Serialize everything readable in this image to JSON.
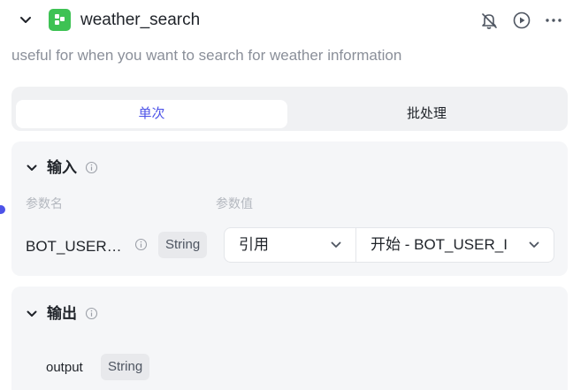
{
  "node": {
    "title": "weather_search",
    "description": "useful for when you want to search for weather information"
  },
  "icons": {
    "collapse": "chevron-down-icon",
    "node": "plugin-node-icon",
    "debug_off": "bell-off-icon",
    "run": "play-circle-icon",
    "more": "more-horizontal-icon",
    "info": "info-icon"
  },
  "tabs": [
    {
      "label": "单次",
      "active": true
    },
    {
      "label": "批处理",
      "active": false
    }
  ],
  "input": {
    "title": "输入",
    "col_name": "参数名",
    "col_value": "参数值",
    "params": [
      {
        "name": "BOT_USER…",
        "type": "String",
        "source": "引用",
        "value": "开始 - BOT_USER_I"
      }
    ]
  },
  "output": {
    "title": "输出",
    "params": [
      {
        "name": "output",
        "type": "String"
      }
    ]
  },
  "colors": {
    "accent": "#4d53e8",
    "node_icon": "#3ec254",
    "card_bg": "#f5f6f8"
  }
}
